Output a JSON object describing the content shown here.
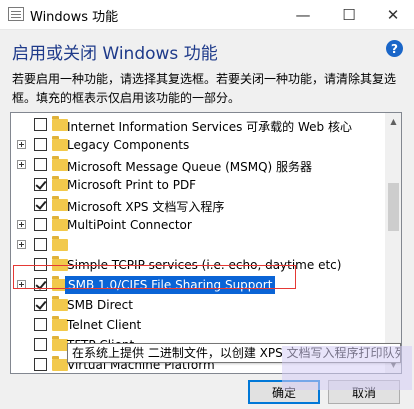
{
  "window": {
    "title": "Windows 功能",
    "min_glyph": "—",
    "max_glyph": "☐",
    "close_glyph": "✕"
  },
  "header": {
    "title": "启用或关闭 Windows 功能",
    "help_glyph": "?",
    "description": "若要启用一种功能，请选择其复选框。若要关闭一种功能，请清除其复选框。填充的框表示仅启用该功能的一部分。"
  },
  "features": [
    {
      "label": "Internet Information Services 可承载的 Web 核心",
      "expandable": false,
      "state": "unchecked"
    },
    {
      "label": "Legacy Components",
      "expandable": true,
      "state": "unchecked"
    },
    {
      "label": "Microsoft Message Queue (MSMQ) 服务器",
      "expandable": true,
      "state": "unchecked"
    },
    {
      "label": "Microsoft Print to PDF",
      "expandable": false,
      "state": "checked"
    },
    {
      "label": "Microsoft XPS 文档写入程序",
      "expandable": false,
      "state": "checked"
    },
    {
      "label": "MultiPoint Connector",
      "expandable": true,
      "state": "unchecked"
    },
    {
      "label": "",
      "expandable": true,
      "state": "unchecked"
    },
    {
      "label": "Simple TCPIP services (i.e. echo, daytime etc)",
      "expandable": false,
      "state": "unchecked"
    },
    {
      "label": "SMB 1.0/CIFS File Sharing Support",
      "expandable": true,
      "state": "checked",
      "selected": true
    },
    {
      "label": "SMB Direct",
      "expandable": false,
      "state": "checked"
    },
    {
      "label": "Telnet Client",
      "expandable": false,
      "state": "unchecked"
    },
    {
      "label": "TFTP Client",
      "expandable": false,
      "state": "unchecked"
    },
    {
      "label": "Virtual Machine Platform",
      "expandable": false,
      "state": "unchecked"
    }
  ],
  "tooltip": "在系统上提供 二进制文件，以创建 XPS 文档写入程序打印队列",
  "buttons": {
    "ok": "确定",
    "cancel": "取消"
  },
  "colors": {
    "accent": "#0a64d6",
    "highlight_frame": "#e53935",
    "heading": "#1e3a8a"
  }
}
